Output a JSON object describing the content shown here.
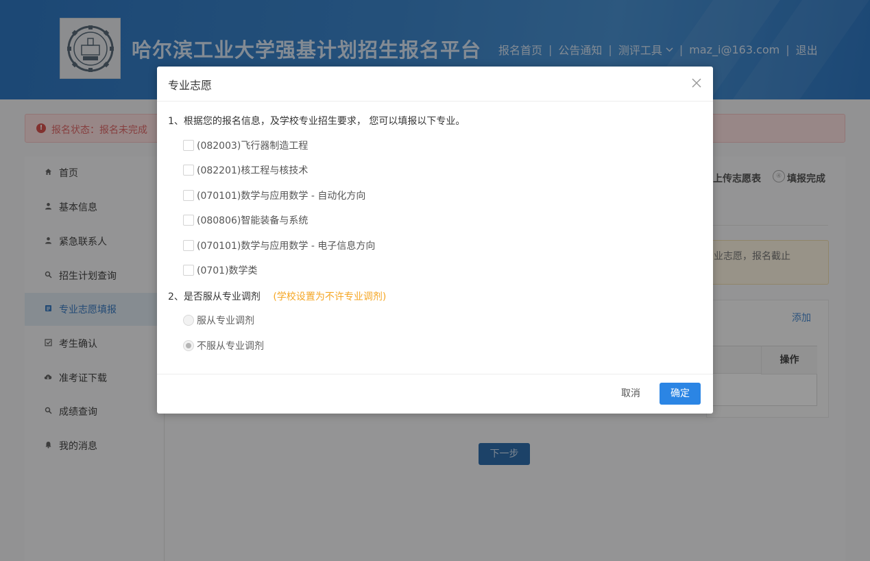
{
  "header": {
    "site_title": "哈尔滨工业大学强基计划招生报名平台",
    "logo_icon": "hit-university-emblem-icon",
    "nav": [
      {
        "label": "报名首页"
      },
      {
        "label": "公告通知"
      },
      {
        "label": "测评工具"
      },
      {
        "label": "maz_i@163.com"
      },
      {
        "label": "退出"
      }
    ],
    "nav_separator": "|"
  },
  "alert": {
    "icon": "exclamation-circle-icon",
    "text": "报名状态：报名未完成"
  },
  "sidebar": {
    "items": [
      {
        "label": "首页",
        "icon": "home-icon"
      },
      {
        "label": "基本信息",
        "icon": "user-icon"
      },
      {
        "label": "紧急联系人",
        "icon": "user-icon"
      },
      {
        "label": "招生计划查询",
        "icon": "search-icon"
      },
      {
        "label": "专业志愿填报",
        "icon": "form-icon",
        "active": true
      },
      {
        "label": "考生确认",
        "icon": "check-square-icon"
      },
      {
        "label": "准考证下载",
        "icon": "cloud-download-icon"
      },
      {
        "label": "成绩查询",
        "icon": "search-icon"
      },
      {
        "label": "我的消息",
        "icon": "bell-icon"
      }
    ]
  },
  "background": {
    "step_upload": "上传志愿表",
    "step_done_number": "④",
    "step_done": "填报完成",
    "warning_text": "业志愿，报名截止",
    "add_link": "添加",
    "table_header_action": "操作",
    "next_button": "下一步"
  },
  "dialog": {
    "title": "专业志愿",
    "close_icon": "close-icon",
    "question1": "1、根据您的报名信息，及学校专业招生要求， 您可以填报以下专业。",
    "majors": [
      {
        "label": "(082003)飞行器制造工程",
        "checked": false
      },
      {
        "label": "(082201)核工程与核技术",
        "checked": false
      },
      {
        "label": "(070101)数学与应用数学 - 自动化方向",
        "checked": false
      },
      {
        "label": "(080806)智能装备与系统",
        "checked": false
      },
      {
        "label": "(070101)数学与应用数学 - 电子信息方向",
        "checked": false
      },
      {
        "label": "(0701)数学类",
        "checked": false
      }
    ],
    "question2": "2、是否服从专业调剂",
    "question2_hint": "(学校设置为不许专业调剂)",
    "adjust_options": [
      {
        "label": "服从专业调剂",
        "selected": false,
        "disabled": true
      },
      {
        "label": "不服从专业调剂",
        "selected": true,
        "disabled": true
      }
    ],
    "cancel_label": "取消",
    "ok_label": "确定"
  },
  "colors": {
    "header_blue": "#3d86cc",
    "primary_button": "#2b85e4",
    "hint_orange": "#f5a623",
    "alert_red": "#e06a6a"
  }
}
